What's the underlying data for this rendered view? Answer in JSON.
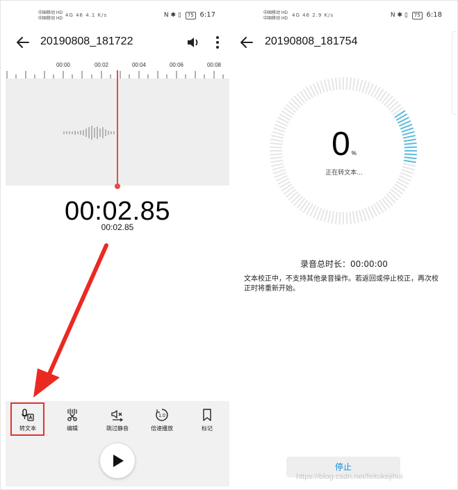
{
  "left_screen": {
    "status": {
      "carriers": [
        "中国移动 HD",
        "中国移动 HD"
      ],
      "network": "4G 46 4.1 K/s",
      "right_icons": "N ✱ ▯",
      "battery": "75",
      "time": "6:17"
    },
    "title": "20190808_181722",
    "timeline_labels": [
      "00:00",
      "00:02",
      "00:04",
      "00:06",
      "00:08"
    ],
    "elapsed": "00:02.85",
    "elapsed_small": "00:02.85",
    "tools": [
      {
        "label": "转文本",
        "icon": "speech-to-text-icon"
      },
      {
        "label": "编辑",
        "icon": "scissors-wave-icon"
      },
      {
        "label": "跳过静音",
        "icon": "skip-silence-icon"
      },
      {
        "label": "倍速播放",
        "icon": "speed-icon"
      },
      {
        "label": "标记",
        "icon": "bookmark-icon"
      }
    ],
    "speed_value": "1.0",
    "accent": "#e84a4a"
  },
  "right_screen": {
    "status": {
      "carriers": [
        "中国移动 HD",
        "中国移动 HD"
      ],
      "network": "4G 46 2.9 K/s",
      "right_icons": "N ✱ ▯",
      "battery": "75",
      "time": "6:18"
    },
    "title": "20190808_181754",
    "progress_value": "0",
    "progress_fraction": 0.0,
    "percent_sign": "%",
    "converting_text": "正在转文本...",
    "total_duration": "录音总时长：00:00:00",
    "notice": "文本校正中，不支持其他录音操作。若返回或停止校正，再次校正时将重新开始。",
    "stop_label": "停止",
    "ring_accent": "#5bbcdc",
    "ring_base": "#e6e6e6"
  },
  "watermark": "https://blog.csdn.net/feitukejihui"
}
